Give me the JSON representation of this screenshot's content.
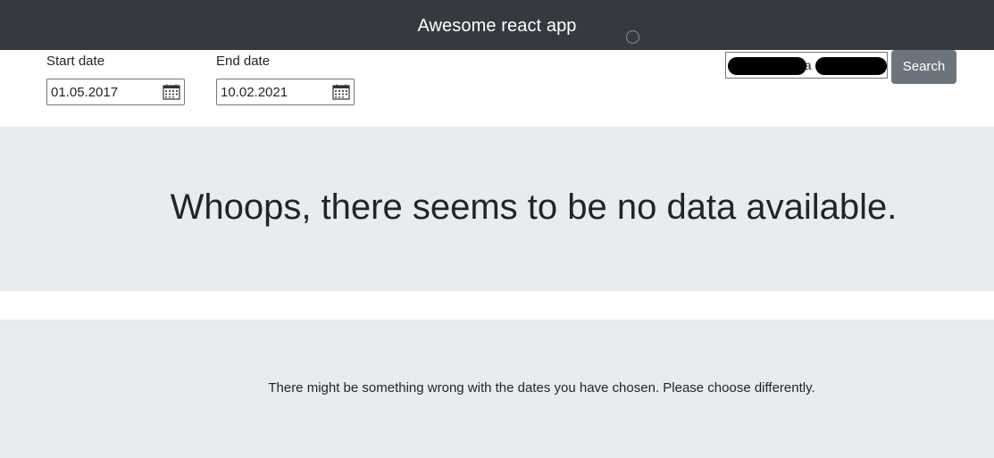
{
  "navbar": {
    "title": "Awesome react app",
    "spinner_icon": "loading-spinner-icon"
  },
  "filters": {
    "start_date": {
      "label": "Start date",
      "value": "01.05.2017",
      "icon": "calendar-icon"
    },
    "end_date": {
      "label": "End date",
      "value": "10.02.2021",
      "icon": "calendar-icon"
    }
  },
  "search": {
    "visible_value_fragment": "2a",
    "button_label": "Search",
    "button_color": "#6c757d"
  },
  "alerts": {
    "no_data_heading": "Whoops, there seems to be no data available.",
    "no_data_hint": "There might be something wrong with the dates you have chosen. Please choose differently."
  },
  "colors": {
    "navbar_bg": "#343a40",
    "jumbotron_bg": "#e9ecef"
  }
}
